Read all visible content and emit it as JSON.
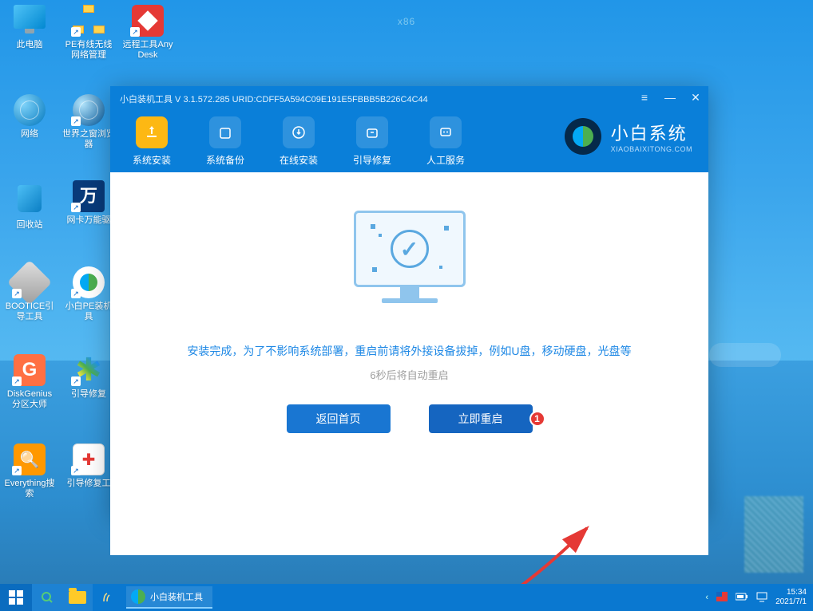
{
  "arch_label": "x86",
  "desktop_icons": [
    {
      "id": "this-pc",
      "label": "此电脑"
    },
    {
      "id": "pe-net",
      "label": "PE有线无线网络管理"
    },
    {
      "id": "anydesk",
      "label": "远程工具AnyDesk"
    },
    {
      "id": "network",
      "label": "网络"
    },
    {
      "id": "world-window",
      "label": "世界之窗浏览器"
    },
    {
      "id": "recycle",
      "label": "回收站"
    },
    {
      "id": "wan-driver",
      "label": "网卡万能驱"
    },
    {
      "id": "bootice",
      "label": "BOOTICE引导工具"
    },
    {
      "id": "xiaobai-pe",
      "label": "小白PE装机具"
    },
    {
      "id": "diskgenius",
      "label": "DiskGenius分区大师"
    },
    {
      "id": "boot-repair",
      "label": "引导修复"
    },
    {
      "id": "everything",
      "label": "Everything搜索"
    },
    {
      "id": "boot-repair-tool",
      "label": "引导修复工"
    }
  ],
  "window": {
    "title": "小白装机工具 V 3.1.572.285 URID:CDFF5A594C09E191E5FBBB5B226C4C44",
    "tabs": [
      {
        "label": "系统安装",
        "active": true
      },
      {
        "label": "系统备份",
        "active": false
      },
      {
        "label": "在线安装",
        "active": false
      },
      {
        "label": "引导修复",
        "active": false
      },
      {
        "label": "人工服务",
        "active": false
      }
    ],
    "brand": {
      "name": "小白系统",
      "url": "XIAOBAIXITONG.COM"
    },
    "message_primary": "安装完成，为了不影响系统部署，重启前请将外接设备拔掉，例如U盘，移动硬盘，光盘等",
    "message_secondary": "6秒后将自动重启",
    "buttons": {
      "back": "返回首页",
      "restart": "立即重启"
    },
    "annotation_number": "1"
  },
  "taskbar": {
    "app_label": "小白装机工具",
    "time": "15:34",
    "date": "2021/7/1"
  }
}
